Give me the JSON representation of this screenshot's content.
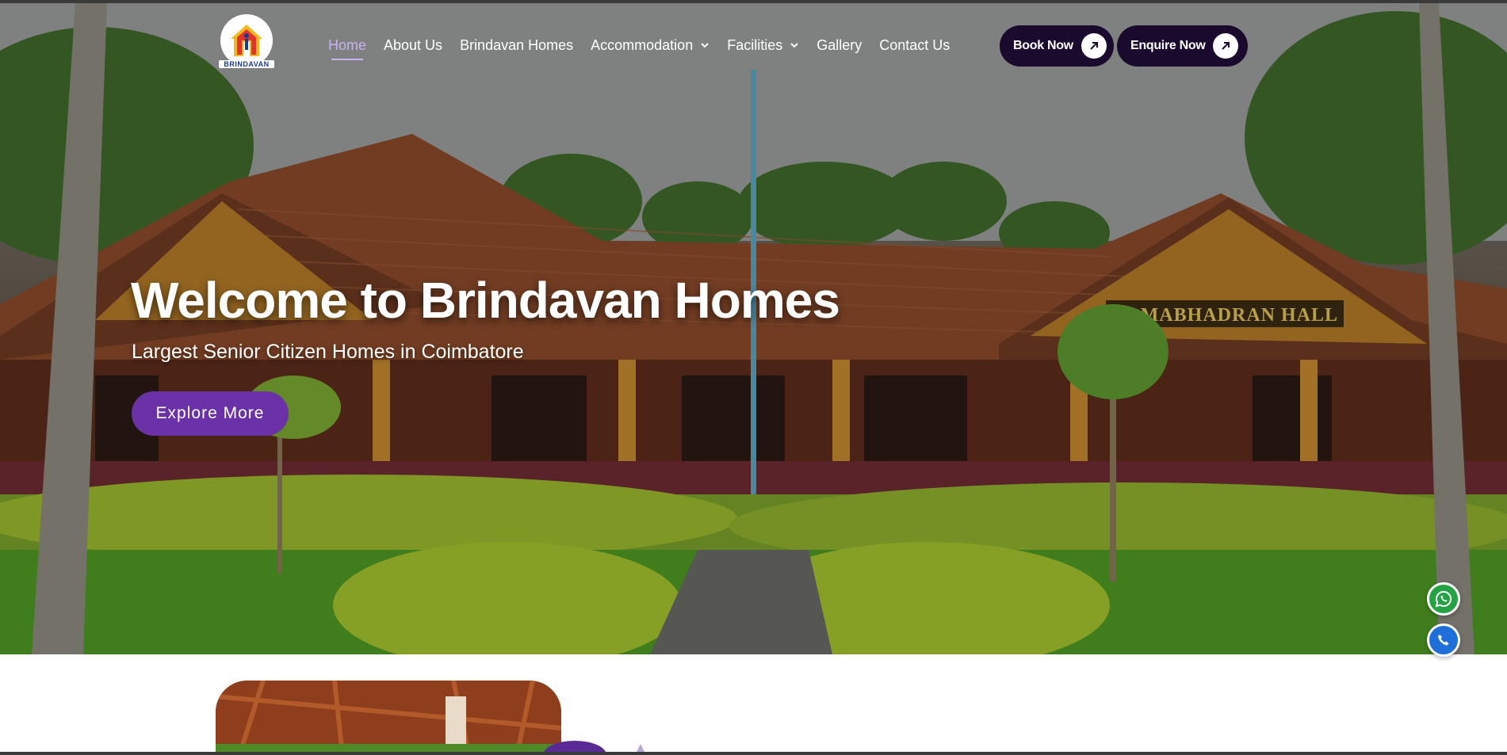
{
  "brand": {
    "name": "BRINDAVAN",
    "colors": {
      "accent": "#6a32a6",
      "dark_cta": "#1a0a2e",
      "active_nav": "#c9b2f0",
      "whatsapp": "#25a244",
      "call": "#1e6fd9"
    }
  },
  "nav": {
    "items": [
      {
        "label": "Home",
        "active": true,
        "dropdown": false
      },
      {
        "label": "About Us",
        "active": false,
        "dropdown": false
      },
      {
        "label": "Brindavan Homes",
        "active": false,
        "dropdown": false
      },
      {
        "label": "Accommodation",
        "active": false,
        "dropdown": true
      },
      {
        "label": "Facilities",
        "active": false,
        "dropdown": true
      },
      {
        "label": "Gallery",
        "active": false,
        "dropdown": false
      },
      {
        "label": "Contact Us",
        "active": false,
        "dropdown": false
      }
    ],
    "book_label": "Book Now",
    "enquire_label": "Enquire Now"
  },
  "hero": {
    "title": "Welcome to Brindavan Homes",
    "subtitle": "Largest Senior Citizen Homes in Coimbatore",
    "button_label": "Explore More",
    "sign_text": "RAMABHADRAN HALL"
  },
  "floating": {
    "whatsapp_icon": "whatsapp-icon",
    "call_icon": "phone-icon"
  }
}
